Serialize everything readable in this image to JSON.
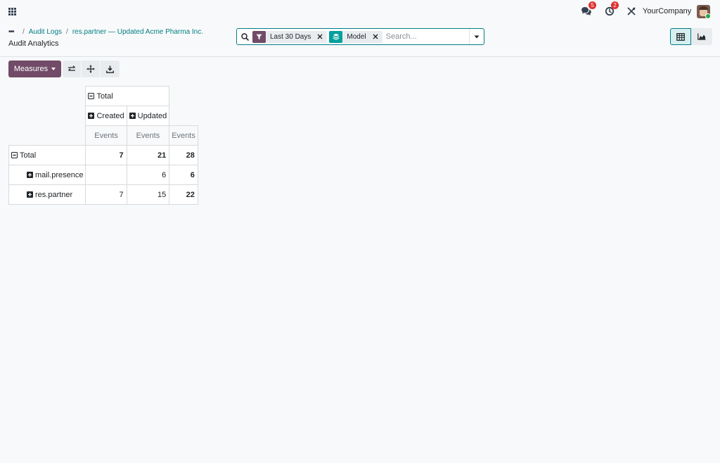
{
  "navbar": {
    "messages_count": "5",
    "activity_count": "2",
    "company": "YourCompany"
  },
  "breadcrumb": {
    "items": [
      "Audit Logs",
      "res.partner — Updated Acme Pharma Inc."
    ],
    "current": "Audit Analytics"
  },
  "search": {
    "facets": [
      {
        "label": "Last 30 Days",
        "icon": "filter-icon",
        "color": "#714b67"
      },
      {
        "label": "Model",
        "icon": "group-by-icon",
        "color": "#00a09d"
      }
    ],
    "placeholder": "Search..."
  },
  "toolbar": {
    "measures_label": "Measures"
  },
  "pivot": {
    "col_total": "Total",
    "col_groups": [
      "Created",
      "Updated"
    ],
    "measure": "Events",
    "rows": [
      {
        "label": "Total",
        "created": "7",
        "updated": "21",
        "total": "28"
      },
      {
        "label": "mail.presence",
        "created": "",
        "updated": "6",
        "total": "6"
      },
      {
        "label": "res.partner",
        "created": "7",
        "updated": "15",
        "total": "22"
      }
    ]
  },
  "colors": {
    "brand": "#714b67",
    "link": "#017e84",
    "badge": "#e03131"
  }
}
